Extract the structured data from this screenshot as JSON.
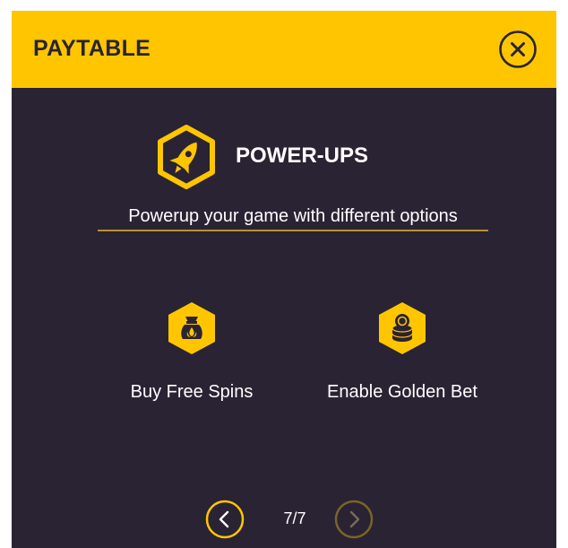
{
  "header": {
    "title": "PAYTABLE",
    "close_icon": "close-icon",
    "background": "#ffc600"
  },
  "section": {
    "icon": "rocket-icon",
    "title": "POWER-UPS",
    "subtitle": "Powerup your game with different options"
  },
  "options": [
    {
      "label": "Buy  Free Spins",
      "icon": "money-bag-icon"
    },
    {
      "label": "Enable Golden Bet",
      "icon": "coin-stack-icon"
    }
  ],
  "pagination": {
    "current": "7/7",
    "prev_icon": "chevron-left-icon",
    "next_icon": "chevron-right-icon"
  },
  "colors": {
    "accent": "#ffc600",
    "background": "#2a2333",
    "divider": "#b8922a",
    "text": "#ffffff"
  }
}
